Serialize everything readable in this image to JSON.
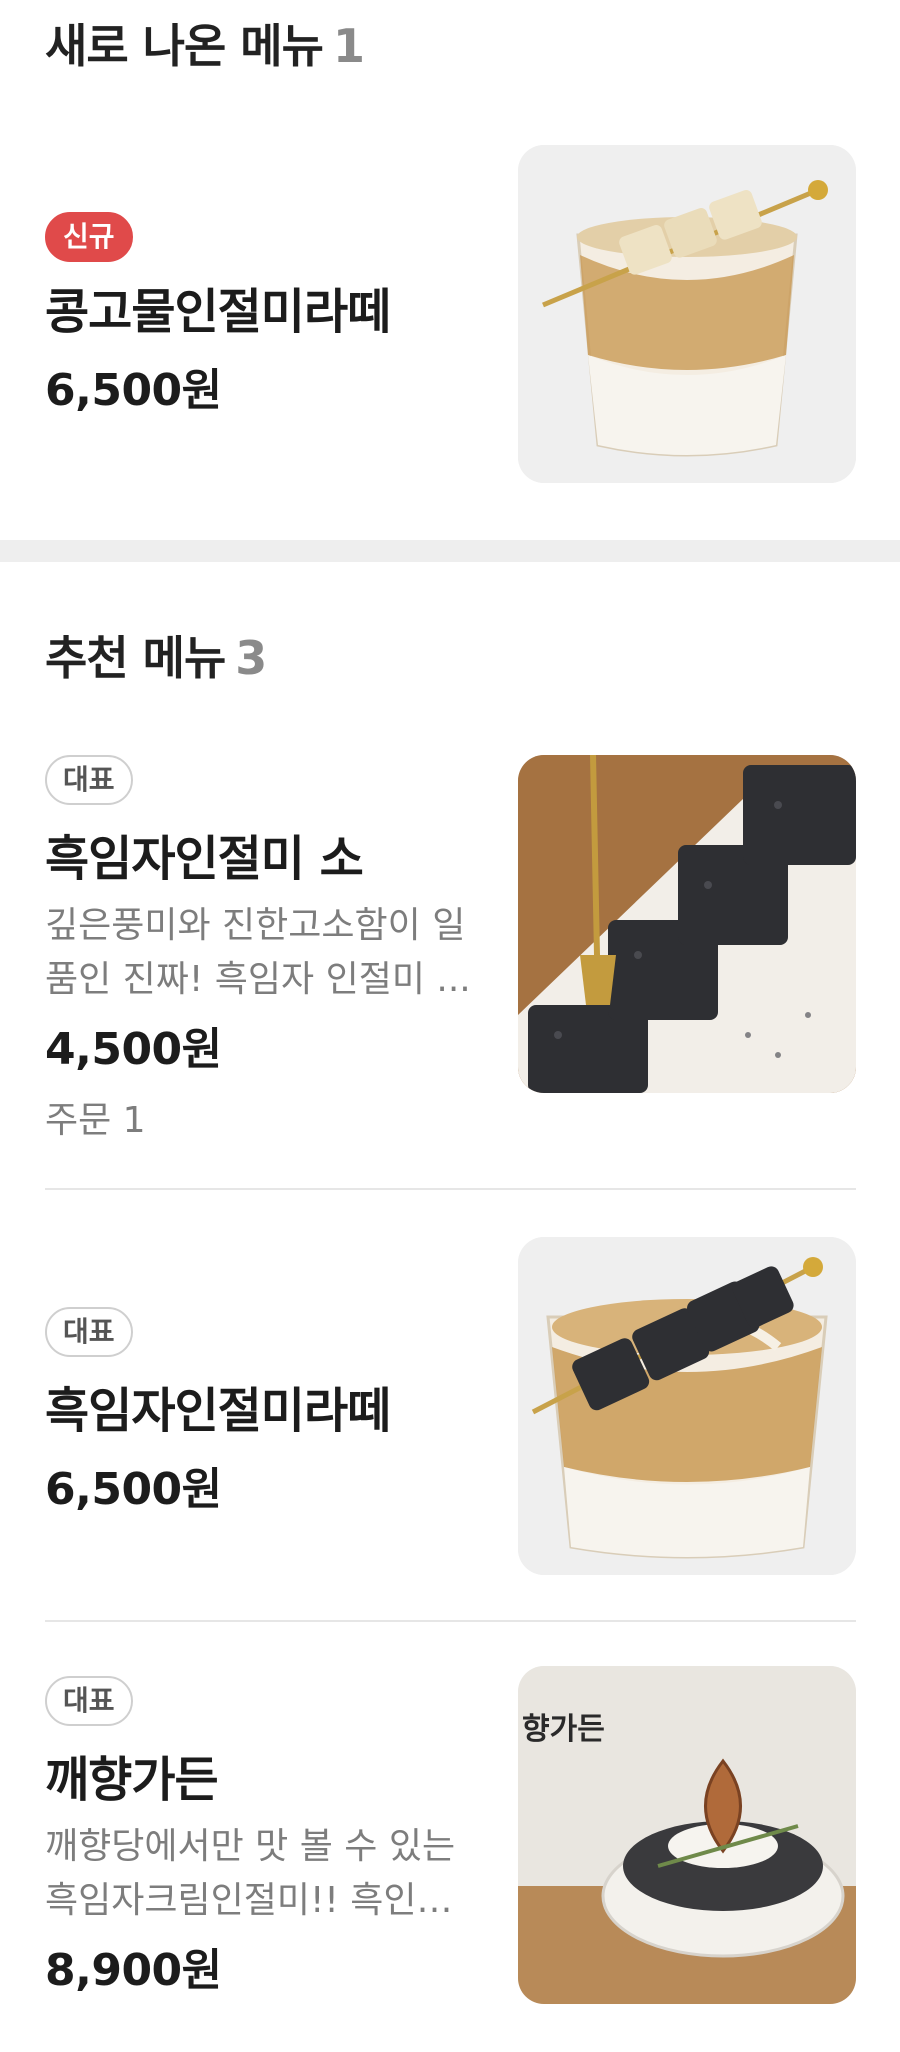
{
  "new_menu": {
    "title": "새로 나온 메뉴",
    "count": "1",
    "items": [
      {
        "badge": "신규",
        "name": "콩고물인절미라떼",
        "price": "6,500원",
        "image": "injeolmi-latte-photo"
      }
    ]
  },
  "recommended": {
    "title": "추천 메뉴",
    "count": "3",
    "items": [
      {
        "badge": "대표",
        "name": "흑임자인절미 소",
        "desc_line1": "깊은풍미와 진한고소함이 일",
        "desc_line2": "품인 진짜! 흑임자 인절미 ...",
        "price": "4,500원",
        "orders": "주문 1",
        "image": "black-sesame-injeolmi-photo"
      },
      {
        "badge": "대표",
        "name": "흑임자인절미라떼",
        "price": "6,500원",
        "image": "black-sesame-latte-photo"
      },
      {
        "badge": "대표",
        "name": "깨향가든",
        "desc_line1": "깨향당에서만 맛 볼 수 있는",
        "desc_line2": "흑임자크림인절미!! 흑인자...",
        "price": "8,900원",
        "image": "kkaehyang-garden-photo",
        "image_caption": "향가든"
      }
    ]
  },
  "colors": {
    "new_badge": "#e04a4a",
    "divider": "#eeeeee",
    "count": "#8a8a8a"
  }
}
